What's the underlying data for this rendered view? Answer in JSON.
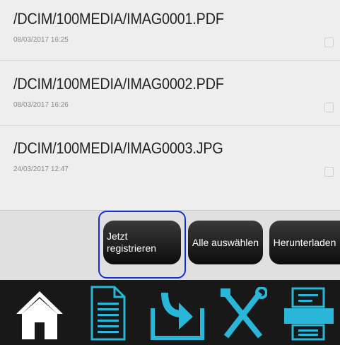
{
  "files": [
    {
      "path": "/DCIM/100MEDIA/IMAG0001.PDF",
      "date": "08/03/2017 16:25"
    },
    {
      "path": "/DCIM/100MEDIA/IMAG0002.PDF",
      "date": "08/03/2017 16:26"
    },
    {
      "path": "/DCIM/100MEDIA/IMAG0003.JPG",
      "date": "24/03/2017 12:47"
    }
  ],
  "actions": {
    "register_label": "Jetzt registrieren",
    "select_all_label": "Alle auswählen",
    "download_label": "Herunterladen"
  },
  "nav": {
    "items": [
      "home-icon",
      "document-icon",
      "download-icon",
      "tools-icon",
      "scanner-icon"
    ],
    "accent_color": "#29b6d8",
    "home_color": "#ffffff"
  }
}
